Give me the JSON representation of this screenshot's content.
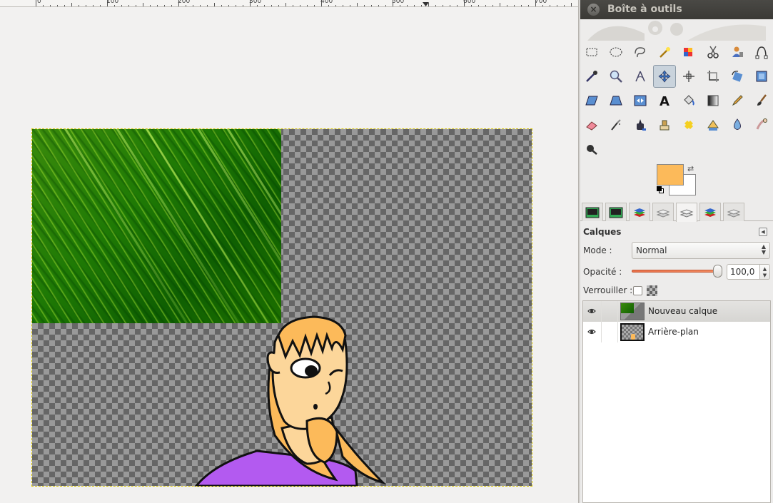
{
  "ruler": {
    "ticks": [
      "0",
      "100",
      "200",
      "300",
      "400",
      "500",
      "600",
      "700"
    ]
  },
  "toolbox": {
    "title": "Boîte à outils",
    "close_icon": "close-icon",
    "tools": [
      {
        "name": "rect-select-icon"
      },
      {
        "name": "ellipse-select-icon"
      },
      {
        "name": "free-select-icon"
      },
      {
        "name": "fuzzy-select-icon"
      },
      {
        "name": "select-by-color-icon"
      },
      {
        "name": "scissors-select-icon"
      },
      {
        "name": "foreground-select-icon"
      },
      {
        "name": "paths-icon"
      },
      {
        "name": "color-picker-icon"
      },
      {
        "name": "zoom-icon"
      },
      {
        "name": "measure-icon"
      },
      {
        "name": "move-icon",
        "active": true
      },
      {
        "name": "align-icon"
      },
      {
        "name": "crop-icon"
      },
      {
        "name": "rotate-icon"
      },
      {
        "name": "scale-icon"
      },
      {
        "name": "shear-icon"
      },
      {
        "name": "perspective-icon"
      },
      {
        "name": "flip-icon"
      },
      {
        "name": "text-icon"
      },
      {
        "name": "bucket-fill-icon"
      },
      {
        "name": "blend-icon"
      },
      {
        "name": "pencil-icon"
      },
      {
        "name": "paintbrush-icon"
      },
      {
        "name": "eraser-icon"
      },
      {
        "name": "airbrush-icon"
      },
      {
        "name": "ink-icon"
      },
      {
        "name": "clone-icon"
      },
      {
        "name": "heal-icon"
      },
      {
        "name": "perspective-clone-icon"
      },
      {
        "name": "blur-icon"
      },
      {
        "name": "smudge-icon"
      },
      {
        "name": "dodge-burn-icon"
      }
    ],
    "colors": {
      "foreground": "#fcba5a",
      "background": "#ffffff"
    }
  },
  "dock_tabs": [
    {
      "name": "tab-image-1"
    },
    {
      "name": "tab-image-2"
    },
    {
      "name": "tab-layers-red"
    },
    {
      "name": "tab-channels"
    },
    {
      "name": "tab-layers-active",
      "active": true
    },
    {
      "name": "tab-layers-red-2"
    },
    {
      "name": "tab-paths"
    }
  ],
  "layers": {
    "title": "Calques",
    "mode_label": "Mode :",
    "mode_value": "Normal",
    "opacity_label": "Opacité :",
    "opacity_value": "100,0",
    "lock_label": "Verrouiller :",
    "items": [
      {
        "name": "Nouveau calque",
        "visible": true,
        "selected": true
      },
      {
        "name": "Arrière-plan",
        "visible": true,
        "selected": false
      }
    ]
  }
}
